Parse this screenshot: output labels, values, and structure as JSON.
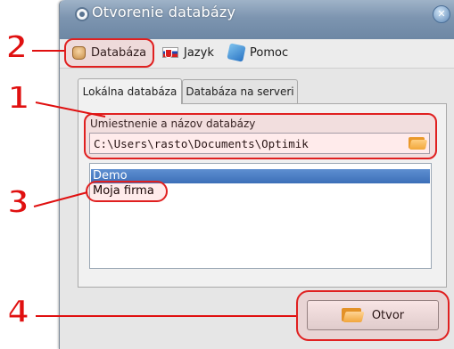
{
  "window": {
    "title": "Otvorenie databázy",
    "close_icon": "close-icon"
  },
  "menu": {
    "items": [
      {
        "label": "Databáza",
        "icon": "database-icon"
      },
      {
        "label": "Jazyk",
        "icon": "slovak-flag-icon"
      },
      {
        "label": "Pomoc",
        "icon": "help-icon"
      }
    ]
  },
  "tabs": [
    {
      "label": "Lokálna databáza",
      "active": true
    },
    {
      "label": "Databáza na serveri",
      "active": false
    }
  ],
  "location": {
    "label": "Umiestnenie a názov databázy",
    "value": "C:\\Users\\rasto\\Documents\\Optimik",
    "browse_icon": "folder-icon"
  },
  "database_list": {
    "items": [
      {
        "label": "Demo",
        "selected": true
      },
      {
        "label": "Moja firma",
        "selected": false
      }
    ]
  },
  "open_button": {
    "label": "Otvor",
    "icon": "folder-open-icon"
  },
  "annotations": {
    "numbers": [
      "1",
      "2",
      "3",
      "4"
    ],
    "color": "#e01010"
  }
}
